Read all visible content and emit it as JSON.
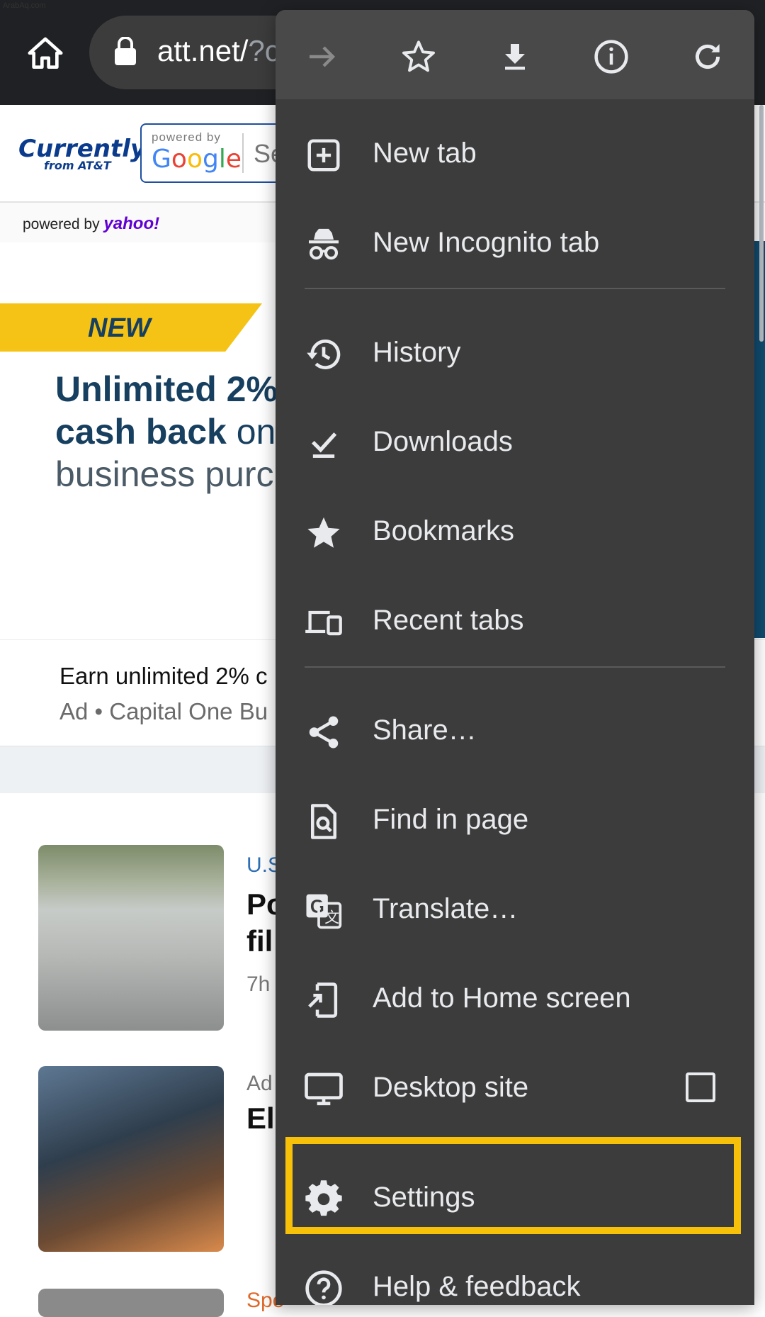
{
  "watermark": "ArabAq.com",
  "browser": {
    "url_host": "att.net/",
    "url_rest": "?c"
  },
  "page": {
    "brand": {
      "name": "Currently",
      "sub": "from AT&T"
    },
    "search": {
      "powered_by": "powered by",
      "engine": "Google",
      "placeholder": "Se"
    },
    "yahoo": {
      "label": "powered by",
      "brand": "yahoo!"
    },
    "ad": {
      "badge": "NEW",
      "line1": "Unlimited 2%",
      "line2_bold": "cash back",
      "line2_rest": " on",
      "line3": "business purc",
      "caption": "Earn unlimited 2% c",
      "sponsor": "Ad • Capital One Bu"
    },
    "news": [
      {
        "category": "U.S",
        "title_1": "Po",
        "title_2": "fil",
        "time": "7h"
      },
      {
        "category": "Ad",
        "title_1": "Ele",
        "title_2": "",
        "time": ""
      },
      {
        "category": "Spo",
        "title_1": "",
        "title_2": "",
        "time": ""
      }
    ]
  },
  "menu": {
    "toolbar": [
      {
        "name": "forward-icon",
        "enabled": false
      },
      {
        "name": "star-icon",
        "enabled": true
      },
      {
        "name": "download-icon",
        "enabled": true
      },
      {
        "name": "info-icon",
        "enabled": true
      },
      {
        "name": "refresh-icon",
        "enabled": true
      }
    ],
    "items": [
      {
        "label": "New tab",
        "icon": "new-tab-icon"
      },
      {
        "label": "New Incognito tab",
        "icon": "incognito-icon"
      },
      {
        "label": "History",
        "icon": "history-icon"
      },
      {
        "label": "Downloads",
        "icon": "downloads-check-icon"
      },
      {
        "label": "Bookmarks",
        "icon": "bookmark-star-icon"
      },
      {
        "label": "Recent tabs",
        "icon": "devices-icon"
      },
      {
        "label": "Share…",
        "icon": "share-icon"
      },
      {
        "label": "Find in page",
        "icon": "find-in-page-icon"
      },
      {
        "label": "Translate…",
        "icon": "translate-icon"
      },
      {
        "label": "Add to Home screen",
        "icon": "add-to-home-icon"
      },
      {
        "label": "Desktop site",
        "icon": "desktop-icon",
        "checked": false
      },
      {
        "label": "Settings",
        "icon": "gear-icon",
        "highlighted": true
      },
      {
        "label": "Help & feedback",
        "icon": "help-icon"
      }
    ],
    "highlight_color": "#f7c10a"
  },
  "colors": {
    "menu_bg": "#3c3c3c",
    "menu_text": "#e8eaed",
    "topbar": "#202124"
  }
}
